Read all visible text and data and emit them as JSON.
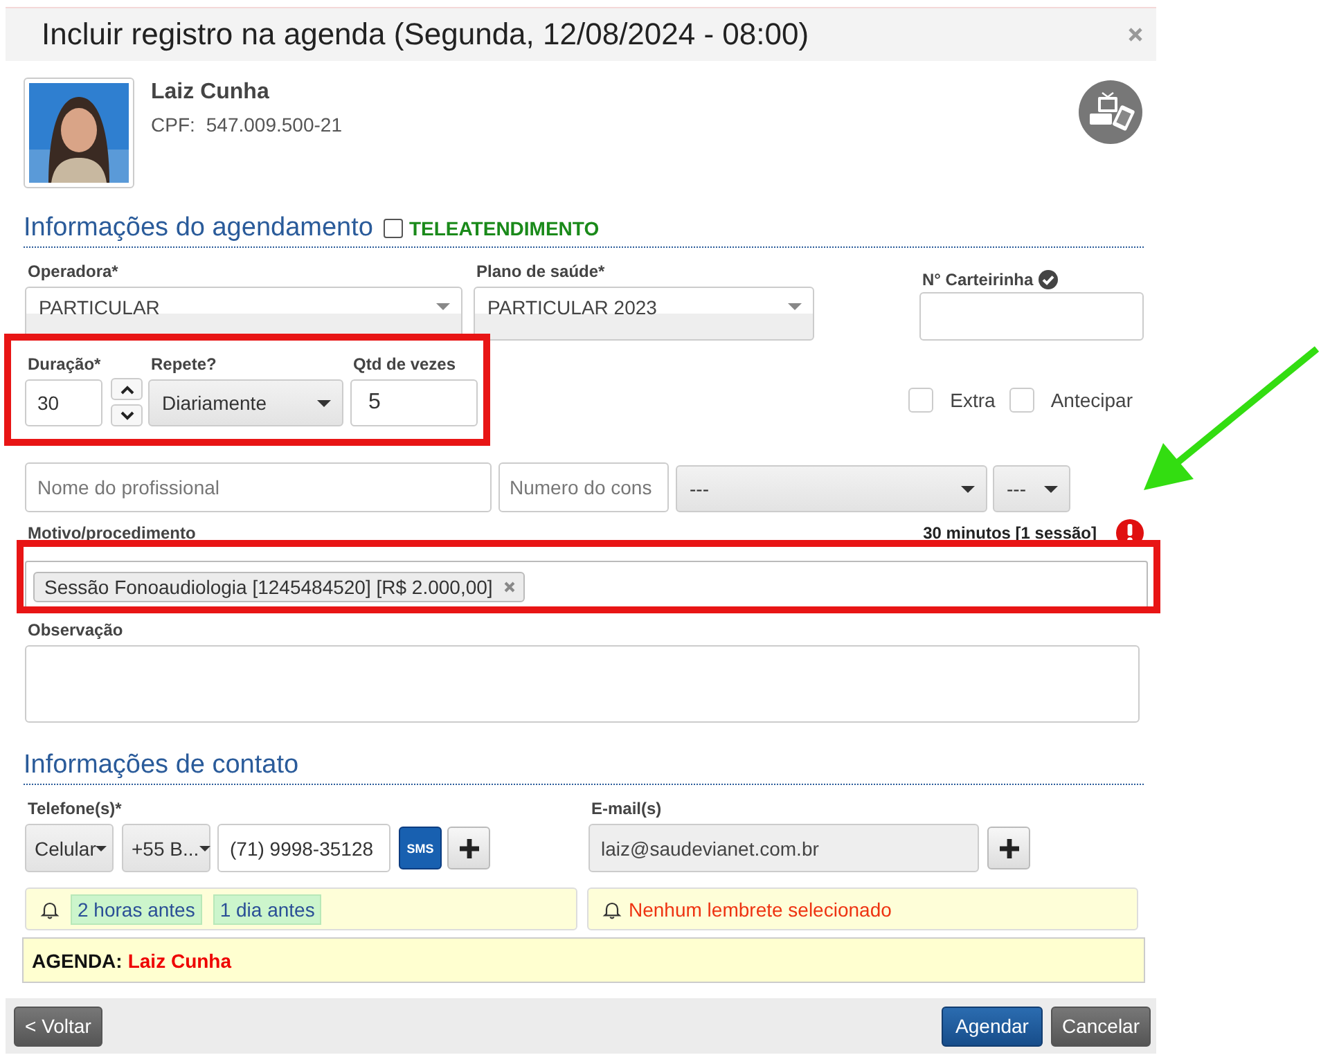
{
  "window": {
    "title": "Incluir registro na agenda (Segunda, 12/08/2024 - 08:00)"
  },
  "patient": {
    "name": "Laiz Cunha",
    "cpf_label": "CPF:",
    "cpf": "547.009.500-21"
  },
  "scheduling": {
    "heading": "Informações do agendamento",
    "teleatendimento": {
      "label": "TELEATENDIMENTO",
      "checked": false
    },
    "operadora": {
      "label": "Operadora*",
      "value": "PARTICULAR"
    },
    "plano": {
      "label": "Plano de saúde*",
      "value": "PARTICULAR 2023"
    },
    "carteirinha": {
      "label": "N° Carteirinha"
    },
    "duracao": {
      "label": "Duração*",
      "value": "30"
    },
    "repete": {
      "label": "Repete?",
      "value": "Diariamente"
    },
    "qtd": {
      "label": "Qtd de vezes",
      "value": "5"
    },
    "options": [
      {
        "label": "Extra",
        "checked": false
      },
      {
        "label": "Antecipar",
        "checked": false
      }
    ],
    "profissional": {
      "name_placeholder": "Nome do profissional",
      "number_placeholder": "Numero do cons",
      "select_1": "---",
      "select_2": "---"
    },
    "motivo": {
      "label": "Motivo/procedimento",
      "summary": "30 minutos [1 sessão]",
      "tags": [
        "Sessão Fonoaudiologia [1245484520] [R$ 2.000,00]"
      ]
    },
    "observacao": {
      "label": "Observação"
    }
  },
  "contact": {
    "heading": "Informações de contato",
    "phone": {
      "label": "Telefone(s)*",
      "type": "Celular",
      "country": "+55 B...",
      "number": "(71) 9998-35128",
      "sms": "SMS"
    },
    "email": {
      "label": "E-mail(s)",
      "value": "laiz@saudevianet.com.br"
    },
    "phone_reminders": [
      "2 horas antes",
      "1 dia antes"
    ],
    "email_reminder": "Nenhum lembrete selecionado",
    "agenda_label": "AGENDA:",
    "agenda_name": "Laiz Cunha"
  },
  "footer": {
    "back": "< Voltar",
    "confirm": "Agendar",
    "cancel": "Cancelar"
  }
}
